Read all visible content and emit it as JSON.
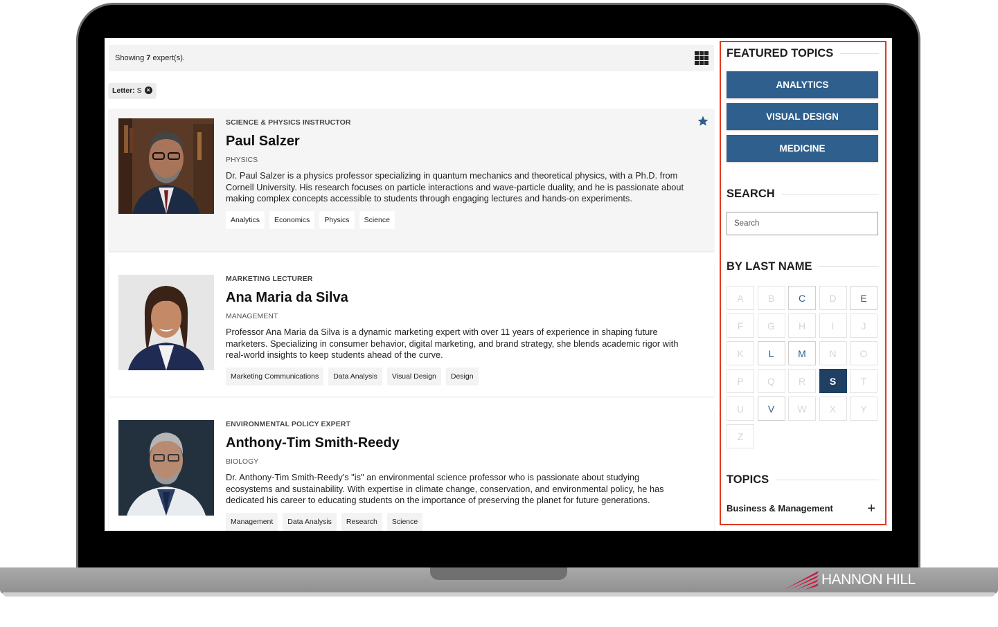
{
  "brand": {
    "name": "HANNON HILL"
  },
  "results": {
    "prefix": "Showing",
    "count": "7",
    "suffix": "expert(s)."
  },
  "filter": {
    "label": "Letter:",
    "value": "S"
  },
  "experts": [
    {
      "role": "SCIENCE & PHYSICS INSTRUCTOR",
      "name": "Paul Salzer",
      "dept": "PHYSICS",
      "desc": "Dr. Paul Salzer is a physics professor specializing in quantum mechanics and theoretical physics, with a Ph.D. from Cornell University. His research focuses on particle interactions and wave-particle duality, and he is passionate about making complex concepts accessible to students through engaging lectures and hands-on experiments.",
      "tags": [
        "Analytics",
        "Economics",
        "Physics",
        "Science"
      ],
      "featured": true
    },
    {
      "role": "MARKETING LECTURER",
      "name": "Ana Maria da Silva",
      "dept": "MANAGEMENT",
      "desc": "Professor Ana Maria da Silva is a dynamic marketing expert with over 11 years of experience in shaping future marketers. Specializing in consumer behavior, digital marketing, and brand strategy, she blends academic rigor with real-world insights to keep students ahead of the curve.",
      "tags": [
        "Marketing Communications",
        "Data Analysis",
        "Visual Design",
        "Design"
      ],
      "featured": false
    },
    {
      "role": "ENVIRONMENTAL POLICY EXPERT",
      "name": "Anthony-Tim Smith-Reedy",
      "dept": "BIOLOGY",
      "desc": "Dr. Anthony-Tim Smith-Reedy's \"is\" an environmental science professor who is passionate about studying ecosystems and sustainability. With expertise in climate change, conservation, and environmental policy, he has dedicated his career to educating students on the importance of preserving the planet for future generations.",
      "tags": [
        "Management",
        "Data Analysis",
        "Research",
        "Science"
      ],
      "featured": false
    }
  ],
  "sidebar": {
    "featured_heading": "FEATURED TOPICS",
    "featured_topics": [
      "ANALYTICS",
      "VISUAL DESIGN",
      "MEDICINE"
    ],
    "search_heading": "SEARCH",
    "search_placeholder": "Search",
    "lastname_heading": "BY LAST NAME",
    "letters": [
      {
        "l": "A",
        "state": "disabled"
      },
      {
        "l": "B",
        "state": "disabled"
      },
      {
        "l": "C",
        "state": "enabled"
      },
      {
        "l": "D",
        "state": "disabled"
      },
      {
        "l": "E",
        "state": "enabled"
      },
      {
        "l": "F",
        "state": "disabled"
      },
      {
        "l": "G",
        "state": "disabled"
      },
      {
        "l": "H",
        "state": "disabled"
      },
      {
        "l": "I",
        "state": "disabled"
      },
      {
        "l": "J",
        "state": "disabled"
      },
      {
        "l": "K",
        "state": "disabled"
      },
      {
        "l": "L",
        "state": "enabled"
      },
      {
        "l": "M",
        "state": "enabled"
      },
      {
        "l": "N",
        "state": "disabled"
      },
      {
        "l": "O",
        "state": "disabled"
      },
      {
        "l": "P",
        "state": "disabled"
      },
      {
        "l": "Q",
        "state": "disabled"
      },
      {
        "l": "R",
        "state": "disabled"
      },
      {
        "l": "S",
        "state": "active"
      },
      {
        "l": "T",
        "state": "disabled"
      },
      {
        "l": "U",
        "state": "disabled"
      },
      {
        "l": "V",
        "state": "enabled"
      },
      {
        "l": "W",
        "state": "disabled"
      },
      {
        "l": "X",
        "state": "disabled"
      },
      {
        "l": "Y",
        "state": "disabled"
      },
      {
        "l": "Z",
        "state": "disabled"
      }
    ],
    "topics_heading": "TOPICS",
    "topics": [
      {
        "label": "Business & Management",
        "icon": "plus-icon"
      }
    ]
  },
  "colors": {
    "accent": "#2f5f8c",
    "active_letter": "#1f3f63",
    "highlight_border": "#e0391f"
  }
}
